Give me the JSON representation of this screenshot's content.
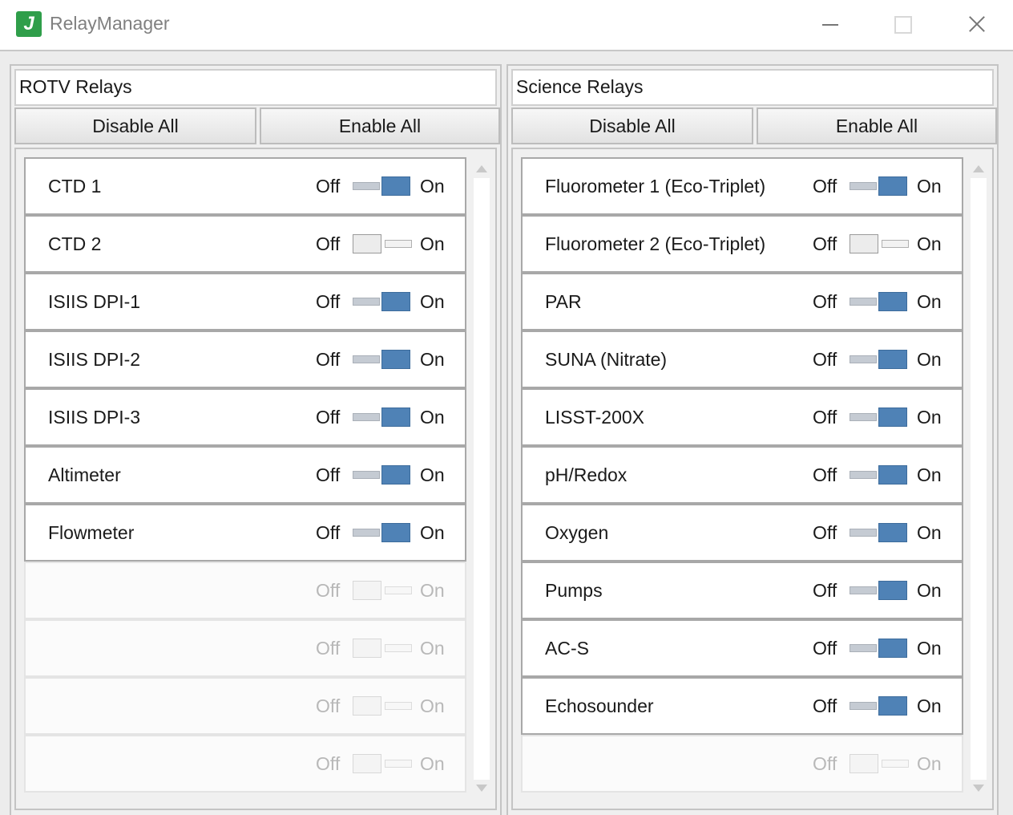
{
  "window": {
    "title": "RelayManager",
    "icon_letter": "J"
  },
  "panels": [
    {
      "title": "ROTV Relays",
      "disable_all_label": "Disable All",
      "enable_all_label": "Enable All",
      "rows": [
        {
          "name": "CTD 1",
          "state": "on",
          "enabled": true
        },
        {
          "name": "CTD 2",
          "state": "off",
          "enabled": true
        },
        {
          "name": "ISIIS DPI-1",
          "state": "on",
          "enabled": true
        },
        {
          "name": "ISIIS DPI-2",
          "state": "on",
          "enabled": true
        },
        {
          "name": "ISIIS DPI-3",
          "state": "on",
          "enabled": true
        },
        {
          "name": "Altimeter",
          "state": "on",
          "enabled": true
        },
        {
          "name": "Flowmeter",
          "state": "on",
          "enabled": true
        },
        {
          "name": "",
          "state": "off",
          "enabled": false
        },
        {
          "name": "",
          "state": "off",
          "enabled": false
        },
        {
          "name": "",
          "state": "off",
          "enabled": false
        },
        {
          "name": "",
          "state": "off",
          "enabled": false
        }
      ]
    },
    {
      "title": "Science Relays",
      "disable_all_label": "Disable All",
      "enable_all_label": "Enable All",
      "rows": [
        {
          "name": "Fluorometer 1 (Eco-Triplet)",
          "state": "on",
          "enabled": true
        },
        {
          "name": "Fluorometer 2 (Eco-Triplet)",
          "state": "off",
          "enabled": true
        },
        {
          "name": "PAR",
          "state": "on",
          "enabled": true
        },
        {
          "name": "SUNA (Nitrate)",
          "state": "on",
          "enabled": true
        },
        {
          "name": "LISST-200X",
          "state": "on",
          "enabled": true
        },
        {
          "name": "pH/Redox",
          "state": "on",
          "enabled": true
        },
        {
          "name": "Oxygen",
          "state": "on",
          "enabled": true
        },
        {
          "name": "Pumps",
          "state": "on",
          "enabled": true
        },
        {
          "name": "AC-S",
          "state": "on",
          "enabled": true
        },
        {
          "name": "Echosounder",
          "state": "on",
          "enabled": true
        },
        {
          "name": "",
          "state": "off",
          "enabled": false
        }
      ]
    }
  ],
  "toggle_labels": {
    "off": "Off",
    "on": "On"
  },
  "colors": {
    "toggle_on": "#4f82b6",
    "app_icon": "#2f9e4a"
  },
  "icons": {
    "app": "app-logo-icon",
    "minimize": "minimize-icon",
    "maximize": "maximize-icon",
    "close": "close-icon",
    "scroll_up": "scroll-up-arrow-icon",
    "scroll_down": "scroll-down-arrow-icon"
  }
}
